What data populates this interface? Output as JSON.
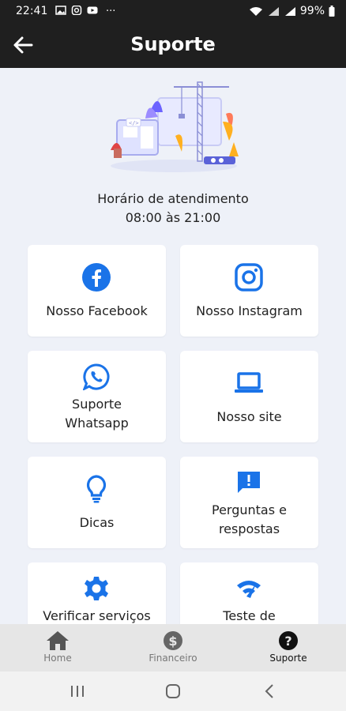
{
  "status_bar": {
    "time": "22:41",
    "more": "···",
    "battery": "99%"
  },
  "app_bar": {
    "title": "Suporte"
  },
  "hours": {
    "title": "Horário de atendimento",
    "time": "08:00 às 21:00"
  },
  "cards": [
    {
      "label": "Nosso Facebook",
      "icon": "facebook-icon"
    },
    {
      "label": "Nosso Instagram",
      "icon": "instagram-icon"
    },
    {
      "label_line1": "Suporte",
      "label_line2": "Whatsapp",
      "icon": "whatsapp-icon"
    },
    {
      "label": "Nosso site",
      "icon": "laptop-icon"
    },
    {
      "label": "Dicas",
      "icon": "lightbulb-icon"
    },
    {
      "label_line1": "Perguntas e",
      "label_line2": "respostas",
      "icon": "feedback-icon"
    },
    {
      "label": "Verificar serviços",
      "icon": "gear-icon"
    },
    {
      "label": "Teste de",
      "icon": "speed-test-icon"
    }
  ],
  "bottom_nav": {
    "home": "Home",
    "financeiro": "Financeiro",
    "suporte": "Suporte"
  },
  "colors": {
    "accent": "#1a73e8",
    "bar": "#1f1f1f",
    "background": "#eef1f8"
  }
}
